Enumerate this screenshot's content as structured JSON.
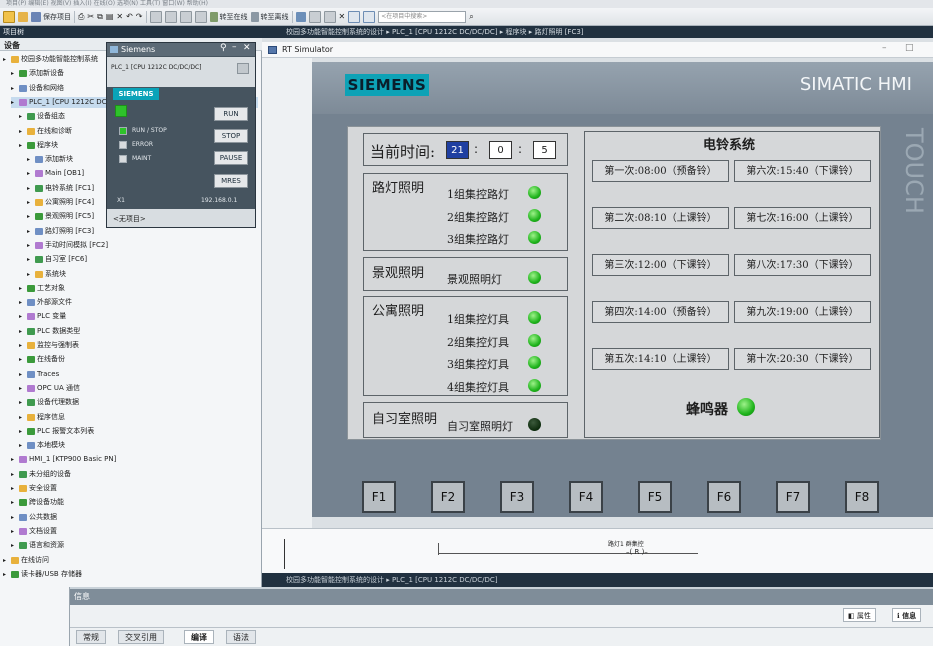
{
  "menu": "项目(P)  编辑(E)  视图(V)  插入(I)  在线(O)  选项(N)  工具(T)  窗口(W)  帮助(H)",
  "toolbar": {
    "save_project": "保存项目",
    "go_online": "转至在线",
    "go_offline": "转至离线",
    "search_placeholder": "<在项目中搜索>"
  },
  "left_panel": {
    "header": "项目树",
    "tab": "设备",
    "items": [
      {
        "label": "校园多功能智能控制系统",
        "indent": 0
      },
      {
        "label": "添加新设备",
        "indent": 1
      },
      {
        "label": "设备和网络",
        "indent": 1
      },
      {
        "label": "PLC_1 [CPU 1212C DC/DC/DC]",
        "indent": 1
      },
      {
        "label": "设备组态",
        "indent": 2
      },
      {
        "label": "在线和诊断",
        "indent": 2
      },
      {
        "label": "程序块",
        "indent": 2
      },
      {
        "label": "添加新块",
        "indent": 3
      },
      {
        "label": "Main [OB1]",
        "indent": 3
      },
      {
        "label": "电铃系统 [FC1]",
        "indent": 3
      },
      {
        "label": "公寓照明 [FC4]",
        "indent": 3
      },
      {
        "label": "景观照明 [FC5]",
        "indent": 3
      },
      {
        "label": "路灯照明 [FC3]",
        "indent": 3
      },
      {
        "label": "手动时间模拟 [FC2]",
        "indent": 3
      },
      {
        "label": "自习室 [FC6]",
        "indent": 3
      },
      {
        "label": "系统块",
        "indent": 3
      },
      {
        "label": "工艺对象",
        "indent": 2
      },
      {
        "label": "外部源文件",
        "indent": 2
      },
      {
        "label": "PLC 变量",
        "indent": 2
      },
      {
        "label": "PLC 数据类型",
        "indent": 2
      },
      {
        "label": "监控与强制表",
        "indent": 2
      },
      {
        "label": "在线备份",
        "indent": 2
      },
      {
        "label": "Traces",
        "indent": 2
      },
      {
        "label": "OPC UA 通信",
        "indent": 2
      },
      {
        "label": "设备代理数据",
        "indent": 2
      },
      {
        "label": "程序信息",
        "indent": 2
      },
      {
        "label": "PLC 报警文本列表",
        "indent": 2
      },
      {
        "label": "本地模块",
        "indent": 2
      },
      {
        "label": "HMI_1 [KTP900 Basic PN]",
        "indent": 1
      },
      {
        "label": "未分组的设备",
        "indent": 1
      },
      {
        "label": "安全设置",
        "indent": 1
      },
      {
        "label": "跨设备功能",
        "indent": 1
      },
      {
        "label": "公共数据",
        "indent": 1
      },
      {
        "label": "文档设置",
        "indent": 1
      },
      {
        "label": "语言和资源",
        "indent": 1
      },
      {
        "label": "在线访问",
        "indent": 0
      },
      {
        "label": "读卡器/USB 存储器",
        "indent": 0
      }
    ]
  },
  "plcsim": {
    "title": "Siemens",
    "device": "PLC_1 [CPU 1212C DC/DC/DC]",
    "brand": "SIEMENS",
    "run_stop": "RUN / STOP",
    "error": "ERROR",
    "maint": "MAINT",
    "btn_run": "RUN",
    "btn_stop": "STOP",
    "btn_pause": "PAUSE",
    "btn_mres": "MRES",
    "interface": "X1",
    "ip": "192.168.0.1",
    "project": "<无项目>"
  },
  "editor": {
    "breadcrumb": "校园多功能智能控制系统的设计 ▸ PLC_1 [CPU 1212C DC/DC/DC] ▸ 程序块 ▸ 路灯照明 [FC3]",
    "breadcrumb2": "校园多功能智能控制系统的设计 ▸ PLC_1 [CPU 1212C DC/DC/DC]"
  },
  "rt": {
    "title": "RT Simulator",
    "siemens_logo": "SIEMENS",
    "hmi_brand": "SIMATIC HMI",
    "touch_text": "TOUCH"
  },
  "hmi": {
    "time_label": "当前时间:",
    "time_h": "21",
    "time_m": "0",
    "time_s": "5",
    "street": {
      "title": "路灯照明",
      "items": [
        {
          "label": "1组集控路灯",
          "on": true
        },
        {
          "label": "2组集控路灯",
          "on": true
        },
        {
          "label": "3组集控路灯",
          "on": true
        }
      ]
    },
    "landscape": {
      "title": "景观照明",
      "label": "景观照明灯",
      "on": true
    },
    "apartment": {
      "title": "公寓照明",
      "items": [
        {
          "label": "1组集控灯具",
          "on": true
        },
        {
          "label": "2组集控灯具",
          "on": true
        },
        {
          "label": "3组集控灯具",
          "on": true
        },
        {
          "label": "4组集控灯具",
          "on": true
        }
      ]
    },
    "study": {
      "title": "自习室照明",
      "label": "自习室照明灯",
      "on": false
    },
    "bell": {
      "title": "电铃系统",
      "buttons": [
        "第一次:08:00（预备铃）",
        "第六次:15:40（下课铃）",
        "第二次:08:10（上课铃）",
        "第七次:16:00（上课铃）",
        "第三次:12:00（下课铃）",
        "第八次:17:30（下课铃）",
        "第四次:14:00（预备铃）",
        "第九次:19:00（上课铃）",
        "第五次:14:10（上课铃）",
        "第十次:20:30（下课铃）"
      ],
      "buzzer_label": "蜂鸣器",
      "buzzer_on": true
    },
    "fkeys": [
      "F1",
      "F2",
      "F3",
      "F4",
      "F5",
      "F6",
      "F7",
      "F8"
    ]
  },
  "ladder": {
    "label": "路灯1 群集控",
    "coil": "R"
  },
  "info": {
    "title": "信息",
    "props_tab": "属性",
    "info_tab": "信息",
    "tabs": [
      "常规",
      "交叉引用",
      "编译",
      "语法"
    ],
    "active_tab": "编译"
  },
  "colors": {
    "siemens_teal": "#0da2b6",
    "led_on": "#1fb41c",
    "led_off": "#0c2a0c",
    "tia_dark": "#213140"
  }
}
